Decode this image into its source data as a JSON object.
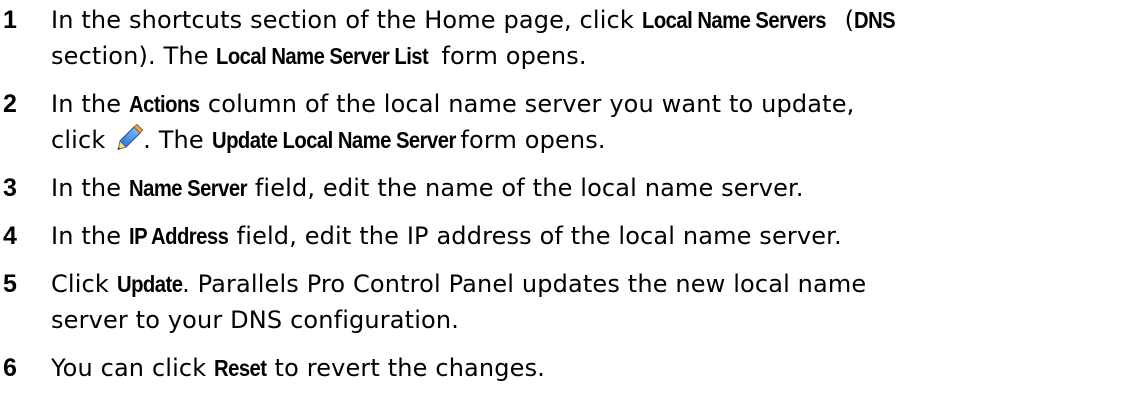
{
  "steps": [
    {
      "num": "1",
      "t1": "In the shortcuts section of the Home page, click ",
      "b1": "Local Name Servers",
      "t2": " (",
      "b2": "DNS",
      "t3": "section).  The ",
      "b3": "Local Name Server List",
      "t4": " form opens."
    },
    {
      "num": "2",
      "t1": "In the ",
      "b1": "Actions",
      "t2": " column of the local name server you want to update,",
      "t3": "click ",
      "icon": "pencil-edit-icon",
      "t4": ". The ",
      "b2": "Update Local Name Server",
      "t5": " form opens."
    },
    {
      "num": "3",
      "t1": "In the ",
      "b1": "Name Server",
      "t2": " field, edit the name of the local name server."
    },
    {
      "num": "4",
      "t1": "In the ",
      "b1": "IP Address",
      "t2": " field, edit the IP address of the local name server."
    },
    {
      "num": "5",
      "t1": "Click ",
      "b1": "Update",
      "t2": ". Parallels Pro Control Panel updates the new local name",
      "t3": "server to your DNS configuration."
    },
    {
      "num": "6",
      "t1": "You can click ",
      "b1": "Reset",
      "t2": " to revert the changes."
    }
  ]
}
